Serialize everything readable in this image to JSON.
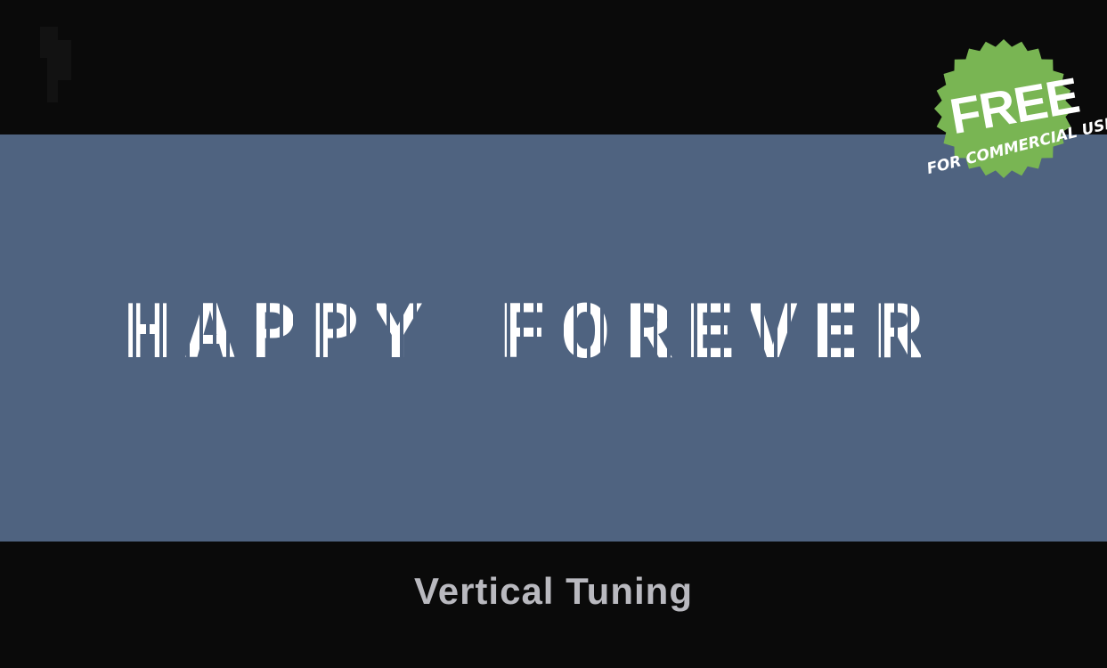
{
  "preview": {
    "sample_text": "HAPPY FOREVER",
    "font_name": "Vertical Tuning",
    "background_color": "#4f6380",
    "text_color": "#ffffff"
  },
  "badge": {
    "title": "FREE",
    "subtitle": "FOR COMMERCIAL USE",
    "color": "#79b553",
    "icon": "starburst-seal"
  }
}
